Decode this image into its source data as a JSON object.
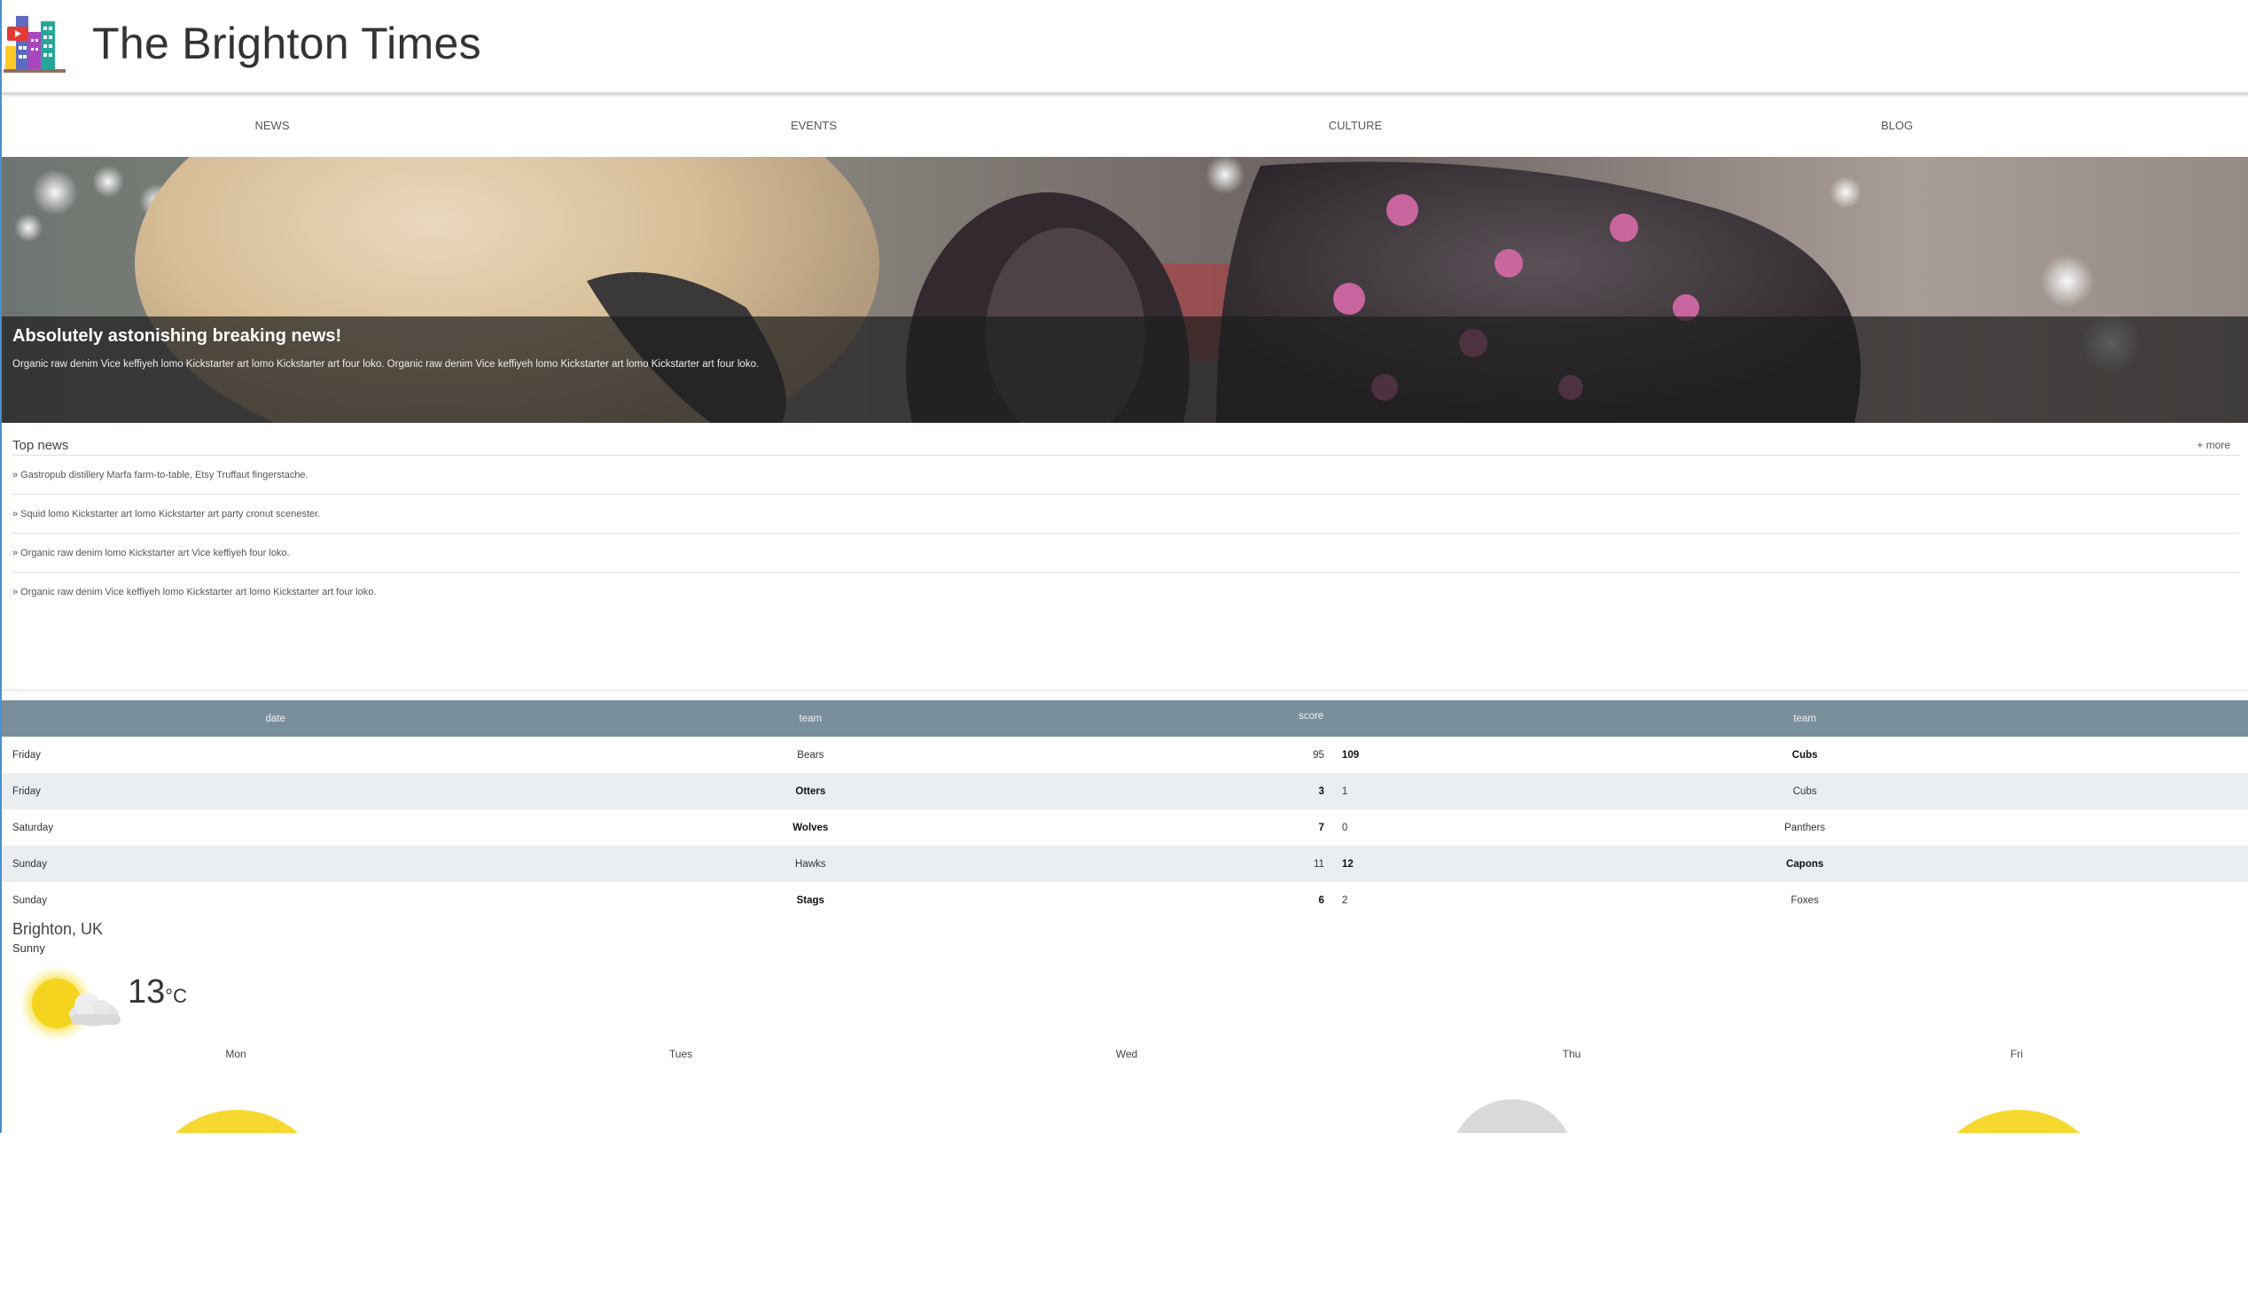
{
  "header": {
    "title": "The Brighton Times"
  },
  "nav": {
    "items": [
      "NEWS",
      "EVENTS",
      "CULTURE",
      "BLOG"
    ]
  },
  "hero": {
    "title": "Absolutely astonishing breaking news!",
    "text": "Organic raw denim Vice keffiyeh lomo Kickstarter art lomo Kickstarter art four loko. Organic raw denim Vice keffiyeh lomo Kickstarter art lomo Kickstarter art four loko."
  },
  "top_news": {
    "title": "Top news",
    "more": "+ more",
    "items": [
      "» Gastropub distillery Marfa farm-to-table, Etsy Truffaut fingerstache.",
      "» Squid lomo Kickstarter art lomo Kickstarter art party cronut scenester.",
      "» Organic raw denim lomo Kickstarter art Vice keffiyeh four loko.",
      "» Organic raw denim Vice keffiyeh lomo Kickstarter art lomo Kickstarter art four loko."
    ]
  },
  "scores": {
    "headers": [
      "date",
      "team",
      "score",
      "team"
    ],
    "rows": [
      {
        "date": "Friday",
        "team1": "Bears",
        "score1": "95",
        "score2": "109",
        "team2": "Cubs",
        "winner": 2
      },
      {
        "date": "Friday",
        "team1": "Otters",
        "score1": "3",
        "score2": "1",
        "team2": "Cubs",
        "winner": 1
      },
      {
        "date": "Saturday",
        "team1": "Wolves",
        "score1": "7",
        "score2": "0",
        "team2": "Panthers",
        "winner": 1
      },
      {
        "date": "Sunday",
        "team1": "Hawks",
        "score1": "11",
        "score2": "12",
        "team2": "Capons",
        "winner": 2
      },
      {
        "date": "Sunday",
        "team1": "Stags",
        "score1": "6",
        "score2": "2",
        "team2": "Foxes",
        "winner": 1
      }
    ]
  },
  "weather": {
    "location": "Brighton, UK",
    "condition": "Sunny",
    "temp": "13",
    "unit": "°C",
    "icon": "sun-cloud-icon",
    "days": [
      "Mon",
      "Tues",
      "Wed",
      "Thu",
      "Fri"
    ],
    "day_icons": [
      "sun-icon",
      "none",
      "none",
      "cloud-icon",
      "sun-icon"
    ]
  },
  "colors": {
    "table_header": "#7a8f9c",
    "row_alt": "#eaeef0",
    "sun": "#f6d92f",
    "cloud": "#d9d9d9"
  }
}
